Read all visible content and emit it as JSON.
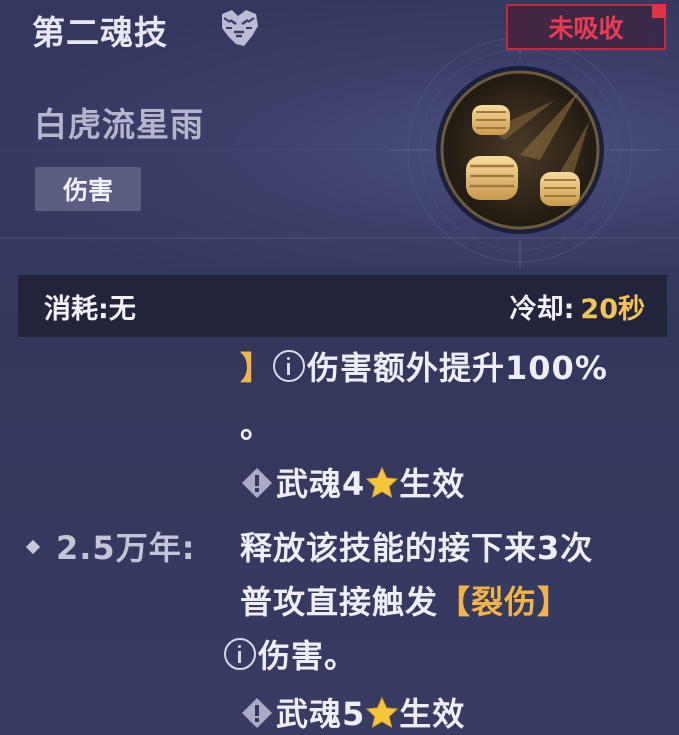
{
  "header": {
    "title": "第二魂技",
    "status": "未吸收",
    "skill_name": "白虎流星雨",
    "tag": "伤害"
  },
  "info": {
    "cost_label": "消耗:",
    "cost_value": "无",
    "cooldown_label": "冷却:",
    "cooldown_value": "20秒"
  },
  "description": {
    "line1_bracket": "】",
    "line1_text": "伤害额外提升100%",
    "line2": "。",
    "line3_pre": "武魂4",
    "line3_post": "生效",
    "tier_label": "2.5万年:",
    "line4": "释放该技能的接下来3次",
    "line5_pre": "普攻直接触发",
    "line5_bracket": "【裂伤】",
    "line6": "伤害。",
    "line7_pre": "武魂5",
    "line7_post": "生效"
  },
  "colors": {
    "accent_gold": "#f0b546",
    "status_red": "#ec3b50",
    "cooldown_gold": "#f3c35a"
  }
}
